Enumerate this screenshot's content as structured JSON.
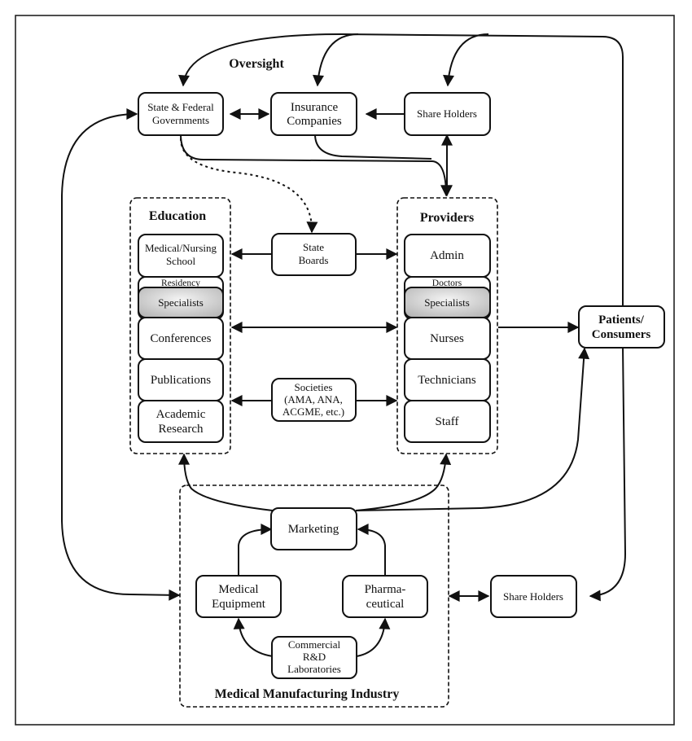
{
  "diagram": {
    "groups": {
      "oversight": {
        "title": "Oversight"
      },
      "education": {
        "title": "Education"
      },
      "providers": {
        "title": "Providers"
      },
      "industry": {
        "title": "Medical Manufacturing Industry"
      }
    },
    "nodes": {
      "governments": [
        "State & Federal",
        "Governments"
      ],
      "insurance": [
        "Insurance",
        "Companies"
      ],
      "shareholders_top": [
        "Share Holders"
      ],
      "state_boards": [
        "State",
        "Boards"
      ],
      "societies": [
        "Societies",
        "(AMA, ANA,",
        "ACGME, etc.)"
      ],
      "patients": [
        "Patients/",
        "Consumers"
      ],
      "shareholders_bottom": [
        "Share Holders"
      ],
      "marketing": [
        "Marketing"
      ],
      "medical_equipment": [
        "Medical",
        "Equipment"
      ],
      "pharmaceutical": [
        "Pharma-",
        "ceutical"
      ],
      "rnd_labs": [
        "Commercial",
        "R&D",
        "Laboratories"
      ]
    },
    "education_items": {
      "school": [
        "Medical/Nursing",
        "School"
      ],
      "residency": "Residency",
      "specialists": "Specialists",
      "conferences": "Conferences",
      "publications": "Publications",
      "research": [
        "Academic",
        "Research"
      ]
    },
    "provider_items": {
      "admin": "Admin",
      "doctors": "Doctors",
      "specialists": "Specialists",
      "nurses": "Nurses",
      "technicians": "Technicians",
      "staff": "Staff"
    },
    "colors": {
      "stroke": "#111111",
      "background": "#ffffff",
      "specialist_fill_light": "#f2f2f2",
      "specialist_fill_dark": "#b8b8b8"
    }
  }
}
